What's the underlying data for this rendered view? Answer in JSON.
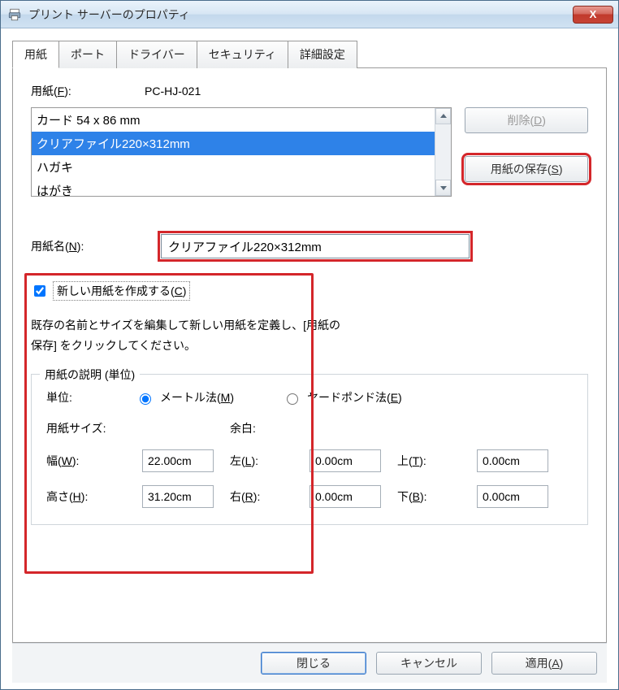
{
  "window": {
    "title": "プリント サーバーのプロパティ",
    "close_x": "X"
  },
  "tabs": {
    "items": [
      {
        "label": "用紙"
      },
      {
        "label": "ポート"
      },
      {
        "label": "ドライバー"
      },
      {
        "label": "セキュリティ"
      },
      {
        "label": "詳細設定"
      }
    ]
  },
  "form": {
    "forms_label_pre": "用紙(",
    "forms_label_key": "F",
    "forms_label_post": "):",
    "server_name": "PC-HJ-021",
    "list": [
      "カード 54 x 86 mm",
      "クリアファイル220×312mm",
      "ハガキ",
      "はがき"
    ],
    "selected_index": 1,
    "delete_pre": "削除(",
    "delete_key": "D",
    "delete_post": ")",
    "save_pre": "用紙の保存(",
    "save_key": "S",
    "save_post": ")",
    "name_label_pre": "用紙名(",
    "name_label_key": "N",
    "name_label_post": "):",
    "name_value": "クリアファイル220×312mm",
    "create_pre": "新しい用紙を作成する(",
    "create_key": "C",
    "create_post": ")",
    "help_line1": "既存の名前とサイズを編集して新しい用紙を定義し、[用紙の",
    "help_line2": "保存] をクリックしてください。"
  },
  "group": {
    "title": "用紙の説明 (単位)",
    "unit_label": "単位:",
    "metric_pre": "メートル法(",
    "metric_key": "M",
    "metric_post": ")",
    "imperial_pre": "ヤードポンド法(",
    "imperial_key": "E",
    "imperial_post": ")",
    "size_label": "用紙サイズ:",
    "margin_label": "余白:",
    "width_pre": "幅(",
    "width_key": "W",
    "width_post": "):",
    "width_val": "22.00cm",
    "left_pre": "左(",
    "left_key": "L",
    "left_post": "):",
    "left_val": "0.00cm",
    "top_pre": "上(",
    "top_key": "T",
    "top_post": "):",
    "top_val": "0.00cm",
    "height_pre": "高さ(",
    "height_key": "H",
    "height_post": "):",
    "height_val": "31.20cm",
    "right_pre": "右(",
    "right_key": "R",
    "right_post": "):",
    "right_val": "0.00cm",
    "bottom_pre": "下(",
    "bottom_key": "B",
    "bottom_post": "):",
    "bottom_val": "0.00cm"
  },
  "footer": {
    "close": "閉じる",
    "cancel": "キャンセル",
    "apply_pre": "適用(",
    "apply_key": "A",
    "apply_post": ")"
  }
}
